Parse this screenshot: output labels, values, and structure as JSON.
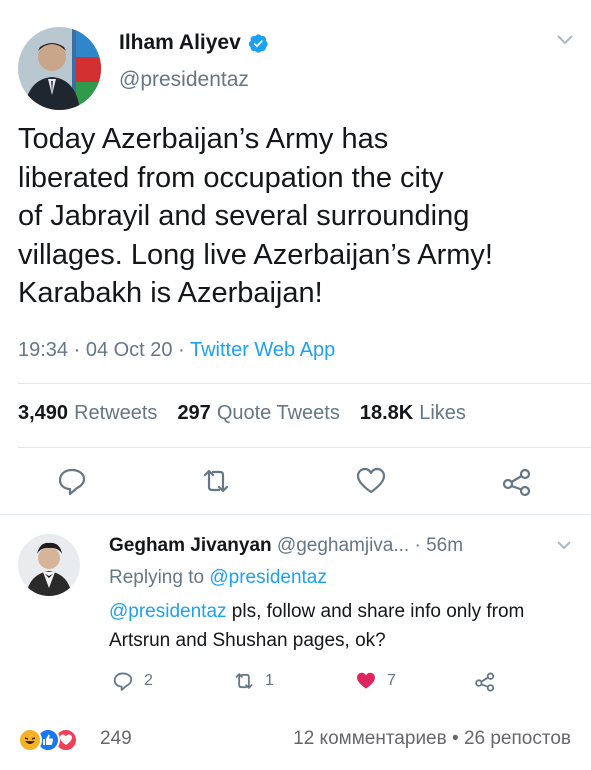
{
  "tweet": {
    "author_name": "Ilham Aliyev",
    "author_handle": "@presidentaz",
    "text_lines": [
      "Today Azerbaijan’s Army has",
      "liberated from occupation the city",
      "of Jabrayil and several surrounding",
      "villages. Long live Azerbaijan’s Army!",
      "Karabakh is Azerbaijan!"
    ],
    "time": "19:34 · 04 Oct 20 · ",
    "app": "Twitter Web App",
    "stats": {
      "retweets_count": "3,490",
      "retweets_label": "Retweets",
      "quotes_count": "297",
      "quotes_label": "Quote Tweets",
      "likes_count": "18.8K",
      "likes_label": "Likes"
    },
    "icons": [
      "reply-icon",
      "retweet-icon",
      "like-icon",
      "share-icon",
      "verified-badge-icon",
      "chevron-down-icon"
    ]
  },
  "reply": {
    "name": "Gegham Jivanyan",
    "handle": "@geghamjiva...",
    "time": "· 56m",
    "replying_prefix": "Replying to ",
    "replying_to": "@presidentaz",
    "mention": "@presidentaz",
    "body_rest": " pls, follow and share info only from Artsrun and Shushan pages, ok?",
    "reply_count": "2",
    "retweet_count": "1",
    "like_count": "7"
  },
  "facebook": {
    "reaction_count": "249",
    "comments": "12 комментариев",
    "separator": " • ",
    "shares": "26 репостов"
  },
  "colors": {
    "accent": "#1da1f2",
    "secondary_text": "#657786",
    "like_red": "#e0245e"
  }
}
